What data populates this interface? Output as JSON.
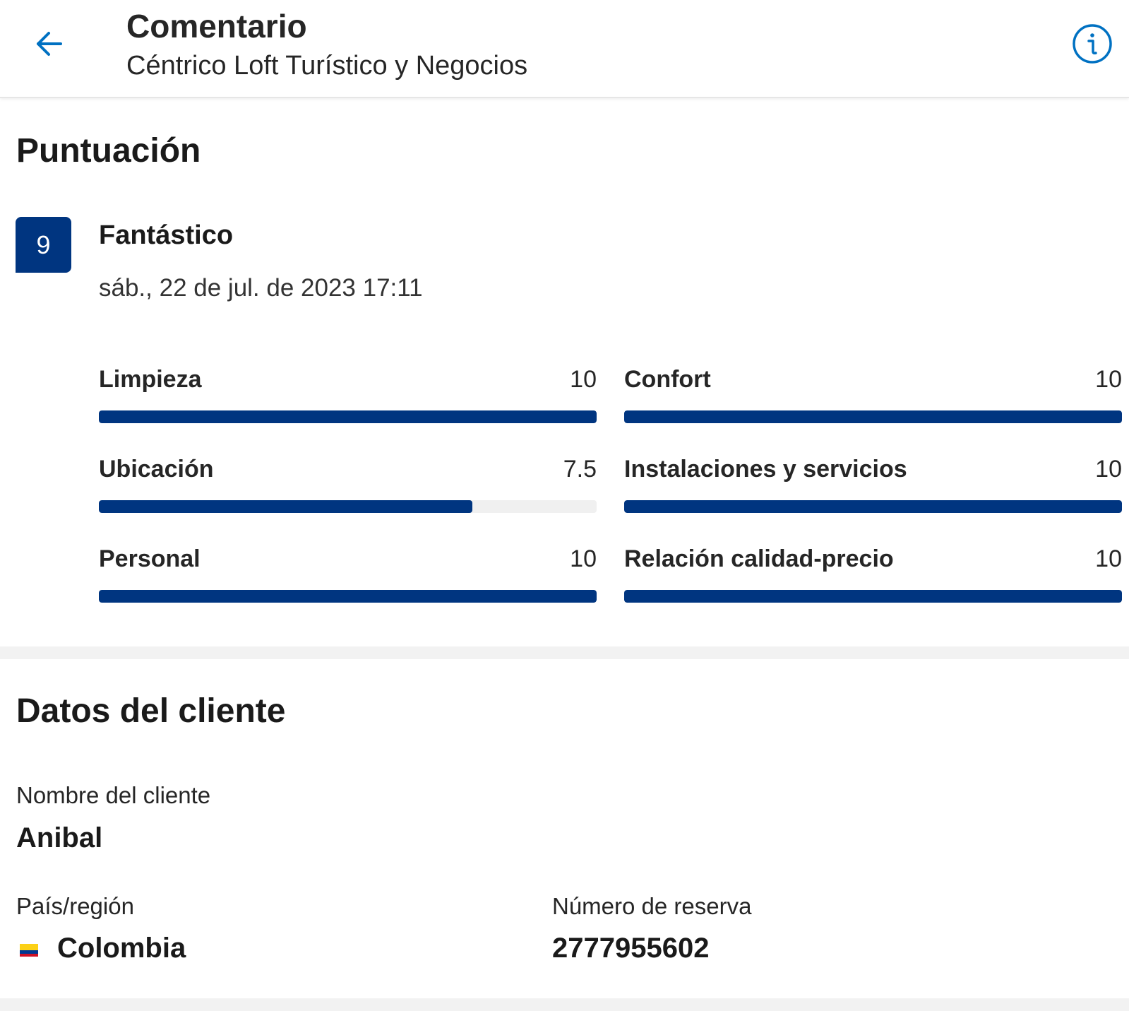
{
  "header": {
    "title": "Comentario",
    "subtitle": "Céntrico Loft Turístico y Negocios",
    "back_icon": "arrow-left-icon",
    "info_icon": "info-icon"
  },
  "score_section": {
    "title": "Puntuación",
    "score": "9",
    "score_word": "Fantástico",
    "date": "sáb., 22 de jul. de 2023 17:11",
    "categories": [
      {
        "label": "Limpieza",
        "value": "10",
        "fraction": 1.0
      },
      {
        "label": "Confort",
        "value": "10",
        "fraction": 1.0
      },
      {
        "label": "Ubicación",
        "value": "7.5",
        "fraction": 0.75
      },
      {
        "label": "Instalaciones y servicios",
        "value": "10",
        "fraction": 1.0
      },
      {
        "label": "Personal",
        "value": "10",
        "fraction": 1.0
      },
      {
        "label": "Relación calidad-precio",
        "value": "10",
        "fraction": 1.0
      }
    ]
  },
  "client_section": {
    "title": "Datos del cliente",
    "name_label": "Nombre del cliente",
    "name_value": "Anibal",
    "country_label": "País/región",
    "country_value": "Colombia",
    "country_flag_icon": "colombia-flag-icon",
    "booking_label": "Número de reserva",
    "booking_value": "2777955602"
  },
  "colors": {
    "accent": "#003580",
    "icon_blue": "#0071c2",
    "track": "#f0f0f0",
    "divider": "#f2f2f2"
  }
}
